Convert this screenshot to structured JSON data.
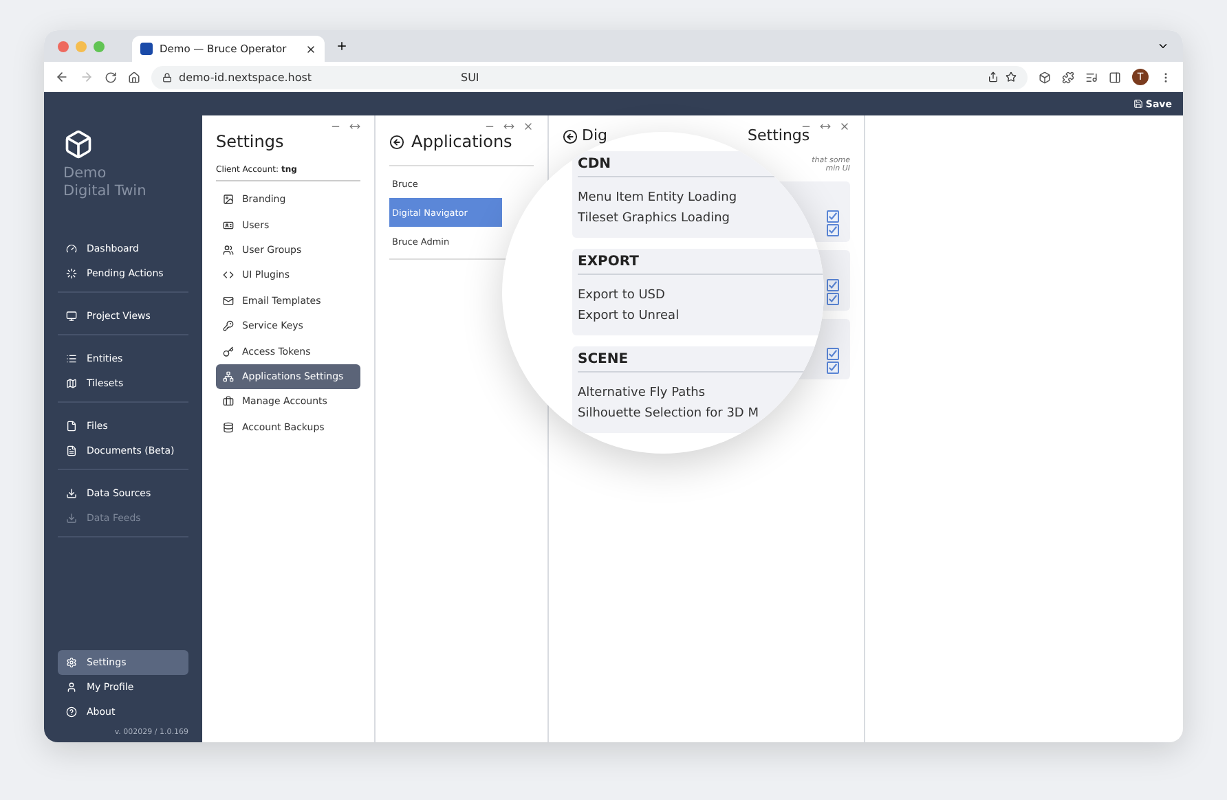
{
  "browser": {
    "tab_title": "Demo — Bruce Operator",
    "url": "demo-id.nextspace.host",
    "page_label": "SUI",
    "avatar": "T"
  },
  "app_bar": {
    "save": "Save"
  },
  "sidebar": {
    "brand": [
      "Demo",
      "Digital Twin"
    ],
    "groups": [
      [
        {
          "label": "Dashboard",
          "selected": false,
          "disabled": false
        },
        {
          "label": "Pending Actions",
          "selected": false,
          "disabled": false
        }
      ],
      [
        {
          "label": "Project Views",
          "selected": false,
          "disabled": false
        }
      ],
      [
        {
          "label": "Entities",
          "selected": false,
          "disabled": false
        },
        {
          "label": "Tilesets",
          "selected": false,
          "disabled": false
        }
      ],
      [
        {
          "label": "Files",
          "selected": false,
          "disabled": false
        },
        {
          "label": "Documents (Beta)",
          "selected": false,
          "disabled": false
        }
      ],
      [
        {
          "label": "Data Sources",
          "selected": false,
          "disabled": false
        },
        {
          "label": "Data Feeds",
          "selected": false,
          "disabled": true
        }
      ]
    ],
    "bottom": [
      {
        "label": "Settings",
        "selected": true,
        "disabled": false
      },
      {
        "label": "My Profile",
        "selected": false,
        "disabled": false
      },
      {
        "label": "About",
        "selected": false,
        "disabled": false
      }
    ],
    "version": "v. 002029 / 1.0.169"
  },
  "settings_panel": {
    "title": "Settings",
    "account_label": "Client Account:",
    "account": "tng",
    "items": [
      {
        "label": "Branding",
        "selected": false
      },
      {
        "label": "Users",
        "selected": false
      },
      {
        "label": "User Groups",
        "selected": false
      },
      {
        "label": "UI Plugins",
        "selected": false
      },
      {
        "label": "Email Templates",
        "selected": false
      },
      {
        "label": "Service Keys",
        "selected": false
      },
      {
        "label": "Access Tokens",
        "selected": false
      },
      {
        "label": "Applications Settings",
        "selected": true
      },
      {
        "label": "Manage Accounts",
        "selected": false
      },
      {
        "label": "Account Backups",
        "selected": false
      }
    ]
  },
  "applications_panel": {
    "title": "Applications",
    "items": [
      {
        "label": "Bruce",
        "selected": false
      },
      {
        "label": "Digital Navigator",
        "selected": true
      },
      {
        "label": "Bruce Admin",
        "selected": false
      }
    ]
  },
  "app_settings_panel": {
    "title_parts": [
      "Dig",
      "Settings"
    ],
    "hint_parts": [
      "that some",
      "min UI"
    ],
    "cards": [
      {
        "checks": [
          true,
          true
        ]
      },
      {
        "checks": [
          true,
          true
        ]
      },
      {
        "checks": [
          true,
          true
        ]
      }
    ]
  },
  "magnifier": {
    "sections": [
      {
        "title": "CDN",
        "items": [
          "Menu Item Entity Loading",
          "Tileset Graphics Loading"
        ]
      },
      {
        "title": "EXPORT",
        "items": [
          "Export to USD",
          "Export to Unreal"
        ]
      },
      {
        "title": "SCENE",
        "items": [
          "Alternative Fly Paths",
          "Silhouette Selection for 3D M"
        ]
      }
    ]
  }
}
